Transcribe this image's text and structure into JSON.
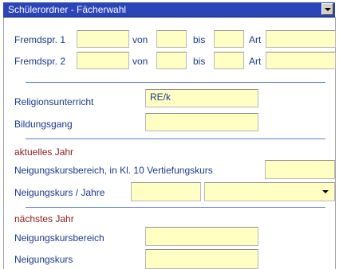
{
  "header": {
    "title": "Schülerordner - Fächerwahl"
  },
  "languages": {
    "row1": {
      "label": "Fremdspr. 1",
      "von_label": "von",
      "bis_label": "bis",
      "art_label": "Art",
      "value": "",
      "von": "",
      "bis": "",
      "art": ""
    },
    "row2": {
      "label": "Fremdspr. 2",
      "von_label": "von",
      "bis_label": "bis",
      "art_label": "Art",
      "value": "",
      "von": "",
      "bis": "",
      "art": ""
    }
  },
  "religion": {
    "label": "Religionsunterricht",
    "value": "RE/k"
  },
  "bildungsgang": {
    "label": "Bildungsgang",
    "value": ""
  },
  "current_year": {
    "heading": "aktuelles Jahr",
    "bereich_label": "Neigungskursbereich, in Kl. 10 Vertiefungskurs",
    "bereich_value": "",
    "kurs_label": "Neigungskurs / Jahre",
    "kurs_value": "",
    "jahre_value": ""
  },
  "next_year": {
    "heading": "nächstes Jahr",
    "bereich_label": "Neigungskursbereich",
    "bereich_value": "",
    "kurs_label": "Neigungskurs",
    "kurs_value": ""
  },
  "colors": {
    "title_bar": "#2a45b8",
    "label": "#1a3a8a",
    "section_heading": "#8b1a1a",
    "field_bg": "#ffffc4",
    "rule": "#5a7fd6"
  }
}
